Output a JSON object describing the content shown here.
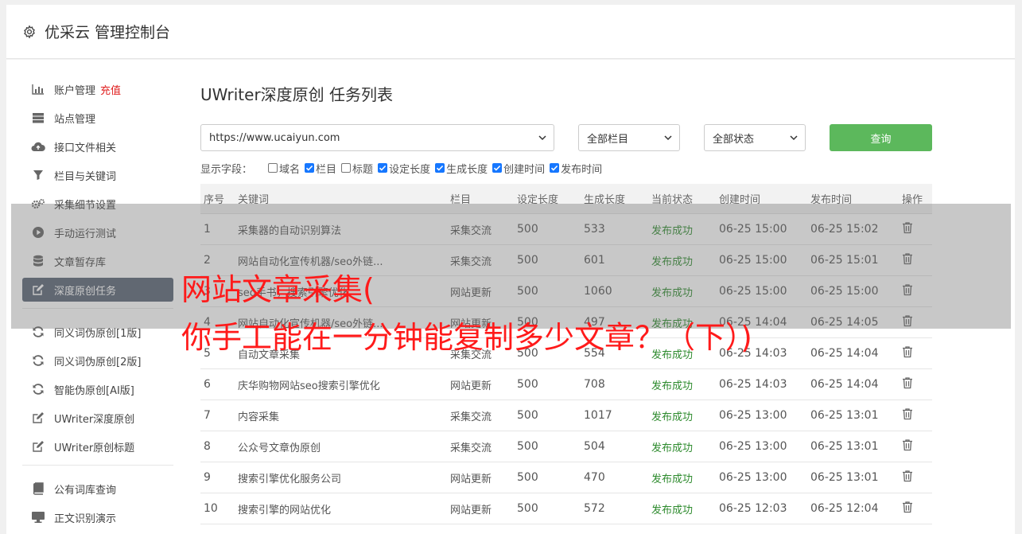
{
  "header": {
    "title": "优采云 管理控制台"
  },
  "sidebar": {
    "groups": [
      [
        {
          "icon": "bar-chart-icon",
          "label": "账户管理",
          "extra": "充值"
        },
        {
          "icon": "server-icon",
          "label": "站点管理"
        },
        {
          "icon": "cloud-upload-icon",
          "label": "接口文件相关"
        },
        {
          "icon": "filter-icon",
          "label": "栏目与关键词"
        },
        {
          "icon": "cogs-icon",
          "label": "采集细节设置"
        },
        {
          "icon": "play-circle-icon",
          "label": "手动运行测试"
        },
        {
          "icon": "database-icon",
          "label": "文章暂存库"
        },
        {
          "icon": "edit-icon",
          "label": "深度原创任务",
          "active": true
        }
      ],
      [
        {
          "icon": "refresh-icon",
          "label": "同义词伪原创[1版]"
        },
        {
          "icon": "refresh-icon",
          "label": "同义词伪原创[2版]"
        },
        {
          "icon": "refresh-icon",
          "label": "智能伪原创[AI版]"
        },
        {
          "icon": "edit-icon",
          "label": "UWriter深度原创"
        },
        {
          "icon": "edit-icon",
          "label": "UWriter原创标题"
        }
      ],
      [
        {
          "icon": "book-icon",
          "label": "公有词库查询"
        },
        {
          "icon": "monitor-icon",
          "label": "正文识别演示"
        }
      ]
    ]
  },
  "page": {
    "title": "UWriter深度原创 任务列表"
  },
  "filters": {
    "site": "https://www.ucaiyun.com",
    "column": "全部栏目",
    "status": "全部状态",
    "query_label": "查询"
  },
  "fields": {
    "label": "显示字段：",
    "items": [
      {
        "label": "域名",
        "checked": false
      },
      {
        "label": "栏目",
        "checked": true
      },
      {
        "label": "标题",
        "checked": false
      },
      {
        "label": "设定长度",
        "checked": true
      },
      {
        "label": "生成长度",
        "checked": true
      },
      {
        "label": "创建时间",
        "checked": true
      },
      {
        "label": "发布时间",
        "checked": true
      }
    ]
  },
  "table": {
    "headers": [
      "序号",
      "关键词",
      "栏目",
      "设定长度",
      "生成长度",
      "当前状态",
      "创建时间",
      "发布时间",
      "操作"
    ],
    "rows": [
      [
        "1",
        "采集器的自动识别算法",
        "采集交流",
        "500",
        "533",
        "发布成功",
        "06-25 15:00",
        "06-25 15:02"
      ],
      [
        "2",
        "网站自动化宣传机器/seo外链...",
        "采集交流",
        "500",
        "601",
        "发布成功",
        "06-25 15:00",
        "06-25 15:01"
      ],
      [
        "3",
        "seo手书，搜索引擎优化",
        "网站更新",
        "500",
        "1060",
        "发布成功",
        "06-25 15:00",
        "06-25 15:00"
      ],
      [
        "4",
        "网站自动化宣传机器/seo外链...",
        "网站更新",
        "500",
        "497",
        "发布成功",
        "06-25 14:04",
        "06-25 14:05"
      ],
      [
        "5",
        "自动文章采集",
        "采集交流",
        "500",
        "554",
        "发布成功",
        "06-25 14:03",
        "06-25 14:04"
      ],
      [
        "6",
        "庆华购物网站seo搜索引擎优化",
        "网站更新",
        "500",
        "708",
        "发布成功",
        "06-25 14:03",
        "06-25 14:04"
      ],
      [
        "7",
        "内容采集",
        "采集交流",
        "500",
        "1017",
        "发布成功",
        "06-25 13:00",
        "06-25 13:01"
      ],
      [
        "8",
        "公众号文章伪原创",
        "采集交流",
        "500",
        "504",
        "发布成功",
        "06-25 13:00",
        "06-25 13:01"
      ],
      [
        "9",
        "搜索引擎优化服务公司",
        "网站更新",
        "500",
        "470",
        "发布成功",
        "06-25 13:00",
        "06-25 13:01"
      ],
      [
        "10",
        "搜索引擎的网站优化",
        "网站更新",
        "500",
        "572",
        "发布成功",
        "06-25 12:03",
        "06-25 12:04"
      ]
    ]
  },
  "overlay": {
    "line1": "网站文章采集(",
    "line2": "你手工能在一分钟能复制多少文章？（下）)"
  },
  "colors": {
    "success": "#2e8b2e",
    "query": "#5cb85c",
    "active_nav": "#5a6474",
    "overlay_text": "#ff1a1a"
  }
}
